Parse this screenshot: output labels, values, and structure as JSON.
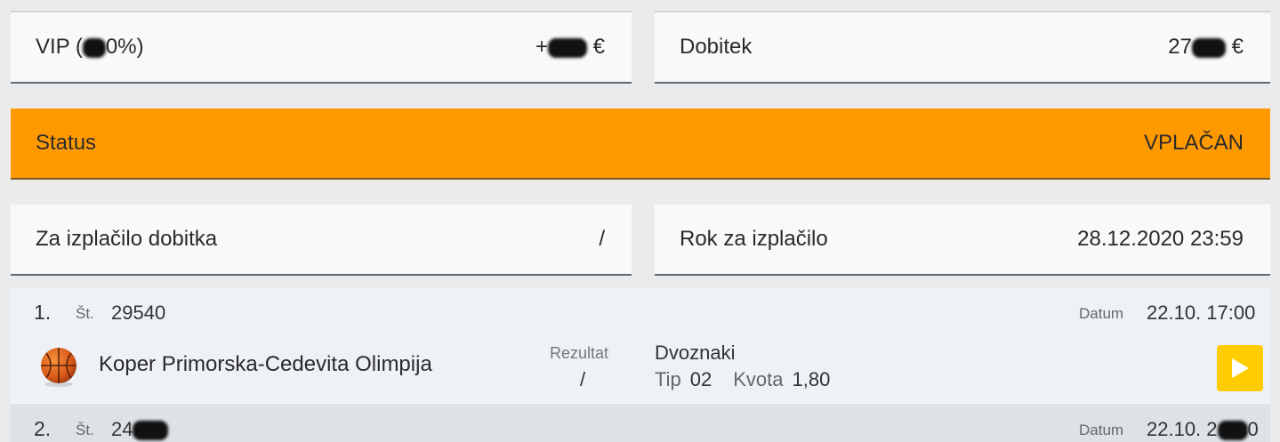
{
  "summary": {
    "vip_label": "VIP (",
    "vip_label_end": "0%)",
    "vip_value_end": "€",
    "dobitek_label": "Dobitek",
    "dobitek_value_start": "27",
    "dobitek_value_end": "€"
  },
  "status": {
    "label": "Status",
    "value": "VPLAČAN",
    "color": "#ff9900"
  },
  "payout": {
    "za_izplacilo_label": "Za izplačilo dobitka",
    "za_izplacilo_value": "/",
    "rok_label": "Rok za izplačilo",
    "rok_value": "28.12.2020 23:59"
  },
  "bets": [
    {
      "index": "1.",
      "st_label": "Št.",
      "st_value": "29540",
      "datum_label": "Datum",
      "datum_value": "22.10. 17:00",
      "sport_icon": "basketball-icon",
      "match": "Koper Primorska-Cedevita Olimpija",
      "rezultat_label": "Rezultat",
      "rezultat_value": "/",
      "market": "Dvoznaki",
      "tip_label": "Tip",
      "tip_value": "02",
      "kvota_label": "Kvota",
      "kvota_value": "1,80",
      "play_icon": "play-icon"
    },
    {
      "index": "2.",
      "st_label": "Št.",
      "st_value_start": "24",
      "datum_label": "Datum",
      "datum_value_start": "22.10. 2",
      "datum_value_end": "0"
    }
  ]
}
